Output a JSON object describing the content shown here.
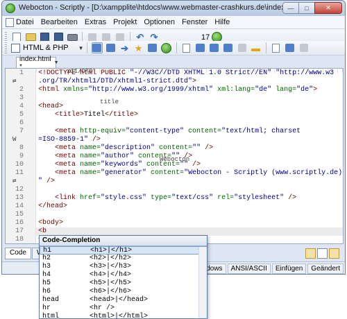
{
  "window": {
    "title": "Webocton - Scriptly - [D:\\xampplite\\htdocs\\www.webmaster-crashkurs.de\\index.html *]",
    "min_glyph": "—",
    "max_glyph": "□",
    "close_glyph": "✕"
  },
  "menu": {
    "items": [
      "Datei",
      "Bearbeiten",
      "Extras",
      "Projekt",
      "Optionen",
      "Fenster",
      "Hilfe"
    ]
  },
  "toolbar": {
    "counter": "17",
    "language": "HTML & PHP"
  },
  "tabs": {
    "active": "index.html *"
  },
  "editor": {
    "lines": [
      {
        "n": "1",
        "parts": [
          [
            "tag",
            "<!DOCTYPE html PUBLIC "
          ],
          [
            "val",
            "\"-//W3C//DTD XHTML 1.0 Strict//EN\" \"http://www.w3"
          ]
        ]
      },
      {
        "n": "",
        "marker": "⇄",
        "parts": [
          [
            "val",
            ".org/TR/xhtml1/DTD/xhtml1-strict.dtd\""
          ],
          [
            "tag",
            ">"
          ]
        ]
      },
      {
        "n": "2",
        "parts": [
          [
            "tag",
            "<html "
          ],
          [
            "attr",
            "xmlns="
          ],
          [
            "val",
            "\"http://www.w3.org/1999/xhtml\" "
          ],
          [
            "attr",
            "xml:lang="
          ],
          [
            "val",
            "\"de\" "
          ],
          [
            "attr",
            "lang="
          ],
          [
            "val",
            "\"de\""
          ],
          [
            "tag",
            ">"
          ]
        ]
      },
      {
        "n": "3",
        "parts": []
      },
      {
        "n": "4",
        "parts": [
          [
            "tag",
            "<head>"
          ]
        ]
      },
      {
        "n": "5",
        "parts": [
          [
            "tag",
            "    <title>"
          ],
          [
            "txt",
            "Titel"
          ],
          [
            "tag",
            "</title>"
          ]
        ]
      },
      {
        "n": "6",
        "parts": []
      },
      {
        "n": "7",
        "parts": [
          [
            "tag",
            "    <meta "
          ],
          [
            "attr",
            "http-equiv="
          ],
          [
            "val",
            "\"content-type\" "
          ],
          [
            "attr",
            "content="
          ],
          [
            "val",
            "\"text/html; charset"
          ]
        ]
      },
      {
        "n": "",
        "marker": "W",
        "parts": [
          [
            "val",
            "=ISO-8859-1\" "
          ],
          [
            "tag",
            "/>"
          ]
        ]
      },
      {
        "n": "8",
        "parts": [
          [
            "tag",
            "    <meta "
          ],
          [
            "attr",
            "name="
          ],
          [
            "val",
            "\"description\" "
          ],
          [
            "attr",
            "content="
          ],
          [
            "val",
            "\"\" "
          ],
          [
            "tag",
            "/>"
          ]
        ]
      },
      {
        "n": "9",
        "parts": [
          [
            "tag",
            "    <meta "
          ],
          [
            "attr",
            "name="
          ],
          [
            "val",
            "\"author\" "
          ],
          [
            "attr",
            "content="
          ],
          [
            "val",
            "\"\" "
          ],
          [
            "tag",
            "/>"
          ]
        ]
      },
      {
        "n": "10",
        "parts": [
          [
            "tag",
            "    <meta "
          ],
          [
            "attr",
            "name="
          ],
          [
            "val",
            "\"keywords\" "
          ],
          [
            "attr",
            "content="
          ],
          [
            "val",
            "\"\" "
          ],
          [
            "tag",
            "/>"
          ]
        ]
      },
      {
        "n": "11",
        "parts": [
          [
            "tag",
            "    <meta "
          ],
          [
            "attr",
            "name="
          ],
          [
            "val",
            "\"generator\" "
          ],
          [
            "attr",
            "content="
          ],
          [
            "val",
            "\"Webocton - Scriptly (www.scriptly.de)"
          ]
        ]
      },
      {
        "n": "",
        "marker": "⇄",
        "parts": [
          [
            "val",
            "\" "
          ],
          [
            "tag",
            "/>"
          ]
        ]
      },
      {
        "n": "12",
        "parts": []
      },
      {
        "n": "13",
        "parts": [
          [
            "tag",
            "    <link "
          ],
          [
            "attr",
            "href="
          ],
          [
            "val",
            "\"style.css\" "
          ],
          [
            "attr",
            "type="
          ],
          [
            "val",
            "\"text/css\" "
          ],
          [
            "attr",
            "rel="
          ],
          [
            "val",
            "\"stylesheet\" "
          ],
          [
            "tag",
            "/>"
          ]
        ]
      },
      {
        "n": "14",
        "parts": [
          [
            "tag",
            "</head>"
          ]
        ]
      },
      {
        "n": "15",
        "parts": []
      },
      {
        "n": "16",
        "parts": [
          [
            "tag",
            "<body>"
          ]
        ]
      },
      {
        "n": "17",
        "parts": [
          [
            "tag",
            "<b"
          ]
        ]
      },
      {
        "n": "18",
        "parts": [
          [
            "tag",
            "<"
          ]
        ]
      },
      {
        "n": "19",
        "parts": []
      }
    ],
    "ghost_texts": [
      "x11/DTD",
      "title",
      "Webocton"
    ]
  },
  "bottom_tabs": [
    "Code",
    "W"
  ],
  "status": {
    "lineend": "Windows",
    "encoding": "ANSI/ASCII",
    "mode": "Einfügen",
    "state": "Geändert"
  },
  "completion": {
    "title": "Code-Completion",
    "items": [
      {
        "key": "h1",
        "value": "<h1>|</h1>"
      },
      {
        "key": "h2",
        "value": "<h2>|</h2>"
      },
      {
        "key": "h3",
        "value": "<h3>|</h3>"
      },
      {
        "key": "h4",
        "value": "<h4>|</h4>"
      },
      {
        "key": "h5",
        "value": "<h5>|</h5>"
      },
      {
        "key": "h6",
        "value": "<h6>|</h6>"
      },
      {
        "key": "head",
        "value": "<head>|</head>"
      },
      {
        "key": "hr",
        "value": "<hr />"
      },
      {
        "key": "html",
        "value": "<html>|</html>"
      }
    ]
  }
}
